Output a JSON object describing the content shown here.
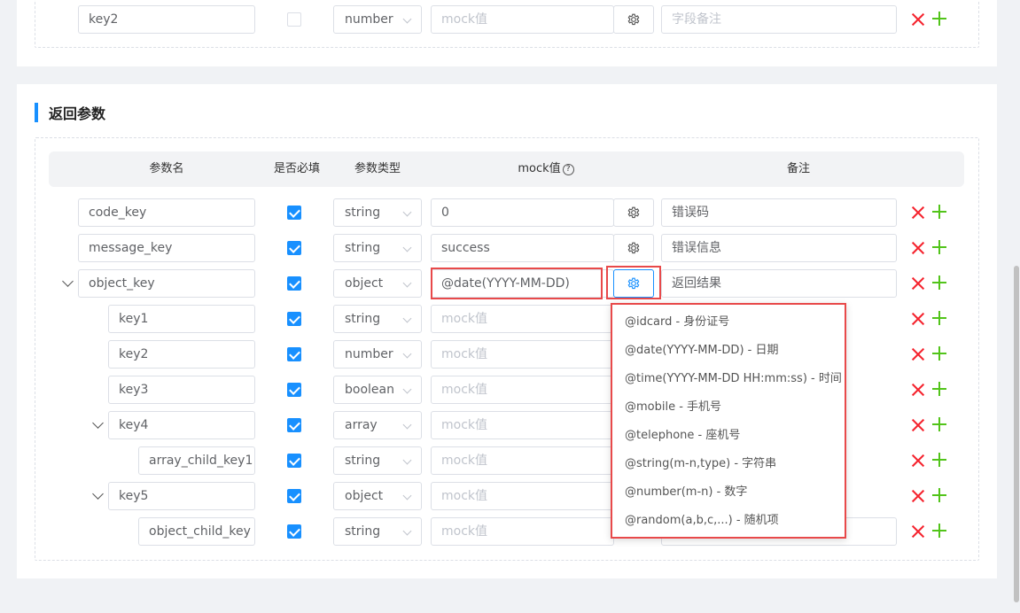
{
  "top_row": {
    "name": "key2",
    "type": "number",
    "mock_placeholder": "mock值",
    "remark_placeholder": "字段备注"
  },
  "section": {
    "title": "返回参数"
  },
  "headers": {
    "name": "参数名",
    "required": "是否必填",
    "type": "参数类型",
    "mock": "mock值",
    "help": "?",
    "remark": "备注"
  },
  "rows": [
    {
      "name": "code_key",
      "type": "string",
      "mock": "0",
      "remark": "错误码"
    },
    {
      "name": "message_key",
      "type": "string",
      "mock": "success",
      "remark": "错误信息"
    },
    {
      "name": "object_key",
      "type": "object",
      "mock": "@date(YYYY-MM-DD)",
      "remark": "返回结果"
    },
    {
      "name": "key1",
      "type": "string",
      "mock": "mock值"
    },
    {
      "name": "key2",
      "type": "number",
      "mock": "mock值"
    },
    {
      "name": "key3",
      "type": "boolean",
      "mock": "mock值"
    },
    {
      "name": "key4",
      "type": "array",
      "mock": "mock值"
    },
    {
      "name": "array_child_key1",
      "type": "string",
      "mock": "mock值"
    },
    {
      "name": "key5",
      "type": "object",
      "mock": "mock值"
    },
    {
      "name": "object_child_key",
      "type": "string",
      "mock": "mock值"
    }
  ],
  "mock_menu": [
    "@idcard - 身份证号",
    "@date(YYYY-MM-DD) - 日期",
    "@time(YYYY-MM-DD HH:mm:ss) - 时间",
    "@mobile - 手机号",
    "@telephone - 座机号",
    "@string(m-n,type) - 字符串",
    "@number(m-n) - 数字",
    "@random(a,b,c,...) - 随机项"
  ],
  "colors": {
    "accent": "#1890ff",
    "danger": "#f5222d",
    "success": "#52c41a",
    "highlight": "#e8494a"
  }
}
